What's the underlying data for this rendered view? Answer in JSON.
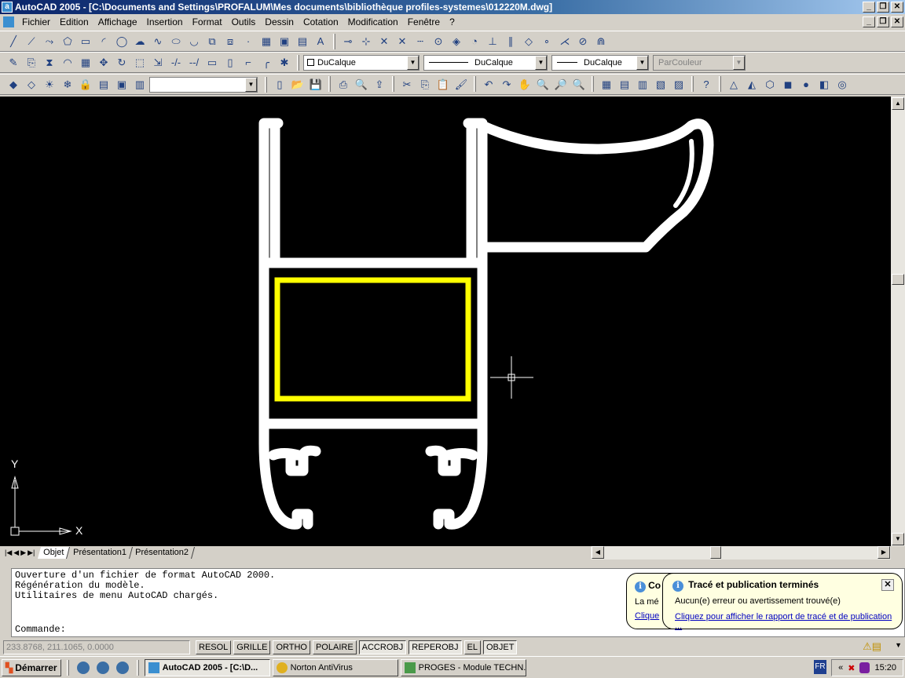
{
  "title": "AutoCAD 2005 - [C:\\Documents and Settings\\PROFALUM\\Mes documents\\bibliothèque profiles-systemes\\012220M.dwg]",
  "window_buttons": [
    "_",
    "❐",
    "✕"
  ],
  "menu": [
    "Fichier",
    "Edition",
    "Affichage",
    "Insertion",
    "Format",
    "Outils",
    "Dessin",
    "Cotation",
    "Modification",
    "Fenêtre",
    "?"
  ],
  "toolbar1_icons": [
    "line-icon",
    "construction-line-icon",
    "polyline-icon",
    "polygon-icon",
    "rectangle-icon",
    "arc-icon",
    "circle-icon",
    "revcloud-icon",
    "spline-icon",
    "ellipse-icon",
    "ellipse-arc-icon",
    "insert-block-icon",
    "make-block-icon",
    "point-icon",
    "hatch-icon",
    "region-icon",
    "table-icon",
    "text-icon",
    "snap-endpoint-icon",
    "snap-midpoint-icon",
    "snap-intersection-icon",
    "snap-apparent-icon",
    "snap-extension-icon",
    "snap-center-icon",
    "snap-quadrant-icon",
    "snap-tangent-icon",
    "snap-perpendicular-icon",
    "snap-parallel-icon",
    "snap-insert-icon",
    "snap-node-icon",
    "snap-nearest-icon",
    "snap-none-icon",
    "osnap-settings-icon"
  ],
  "toolbar1_glyphs": [
    "╱",
    "⟋",
    "⤳",
    "⬠",
    "▭",
    "◜",
    "◯",
    "☁",
    "∿",
    "⬭",
    "◡",
    "⧉",
    "⧈",
    "·",
    "▦",
    "▣",
    "▤",
    "A",
    "⊸",
    "⊹",
    "✕",
    "✕",
    "┄",
    "⊙",
    "◈",
    "◔",
    "⊥",
    "∥",
    "◇",
    "∘",
    "⋌",
    "⊘",
    "⋒"
  ],
  "toolbar2_icons": [
    "erase-icon",
    "copy-icon",
    "mirror-icon",
    "offset-icon",
    "array-icon",
    "move-icon",
    "rotate-icon",
    "scale-icon",
    "stretch-icon",
    "trim-icon",
    "extend-icon",
    "break-icon",
    "break-point-icon",
    "chamfer-icon",
    "fillet-icon",
    "explode-icon"
  ],
  "toolbar2_glyphs": [
    "✎",
    "⎘",
    "⧗",
    "◠",
    "▦",
    "✥",
    "↻",
    "⬚",
    "⇲",
    "-/-",
    "--/",
    "▭",
    "▯",
    "⌐",
    "╭",
    "✱"
  ],
  "layer_combo": "DuCalque",
  "linetype_combo": "DuCalque",
  "lineweight_combo": "DuCalque",
  "color_combo": "ParCouleur",
  "toolbar3_icons": [
    "layer-manager-icon",
    "layer-previous-icon",
    "layer-on-icon",
    "layer-freeze-icon",
    "layer-lock-icon",
    "layer-state-icon",
    "make-current-icon",
    "layer-icon"
  ],
  "toolbar3_glyphs": [
    "◆",
    "◇",
    "☀",
    "❄",
    "🔒",
    "▤",
    "▣",
    "▥"
  ],
  "layer_select": "",
  "toolbar4_icons": [
    "new-icon",
    "open-icon",
    "save-icon",
    "print-icon",
    "preview-icon",
    "publish-icon",
    "cut-icon",
    "copy-clip-icon",
    "paste-icon",
    "match-prop-icon",
    "undo-icon",
    "redo-icon",
    "pan-icon",
    "zoom-realtime-icon",
    "zoom-window-icon",
    "zoom-previous-icon",
    "properties-icon",
    "design-center-icon",
    "tool-palettes-icon",
    "markup-icon",
    "dbconnect-icon",
    "help-icon",
    "view-2d-icon",
    "view-hide-icon",
    "view-3d-icon",
    "view-shade-icon",
    "view-render-icon",
    "view-box-icon",
    "view-orbit-icon"
  ],
  "toolbar4_glyphs": [
    "▯",
    "📂",
    "💾",
    "⎙",
    "🔍",
    "⇪",
    "✂",
    "⎘",
    "📋",
    "🖌",
    "↶",
    "↷",
    "✋",
    "🔍",
    "🔎",
    "🔍",
    "▦",
    "▤",
    "▥",
    "▧",
    "▨",
    "?",
    "△",
    "◭",
    "⬡",
    "◼",
    "●",
    "◧",
    "◎"
  ],
  "tabs": [
    "Objet",
    "Présentation1",
    "Présentation2"
  ],
  "ucs": {
    "x": "X",
    "y": "Y"
  },
  "command_lines": [
    "Ouverture d'un fichier de format AutoCAD 2000.",
    "Régénération du modèle.",
    "Utilitaires de menu AutoCAD chargés."
  ],
  "command_prompt": "Commande:",
  "coords": "233.8768, 211.1065, 0.0000",
  "status_buttons": [
    {
      "label": "RESOL",
      "on": false
    },
    {
      "label": "GRILLE",
      "on": false
    },
    {
      "label": "ORTHO",
      "on": false
    },
    {
      "label": "POLAIRE",
      "on": false
    },
    {
      "label": "ACCROBJ",
      "on": true
    },
    {
      "label": "REPEROBJ",
      "on": true
    },
    {
      "label": "EL",
      "on": false
    },
    {
      "label": "OBJET",
      "on": true
    }
  ],
  "balloon_back": {
    "title": "Co",
    "text": "La mé",
    "link": "Clique"
  },
  "balloon_front": {
    "title": "Tracé et publication terminés",
    "text": "Aucun(e) erreur ou avertissement trouvé(e)",
    "link": "Cliquez pour afficher le rapport de tracé et de publication ..."
  },
  "taskbar": {
    "start": "Démarrer",
    "tasks": [
      "AutoCAD 2005 - [C:\\D...",
      "Norton AntiVirus",
      "PROGES - Module TECHN..."
    ],
    "lang": "FR",
    "tray_chevron": "«",
    "clock": "15:20"
  },
  "colors": {
    "canvas": "#000000",
    "profile": "#ffffff",
    "selection": "#ffff00",
    "titlebar": "#0a246a"
  }
}
